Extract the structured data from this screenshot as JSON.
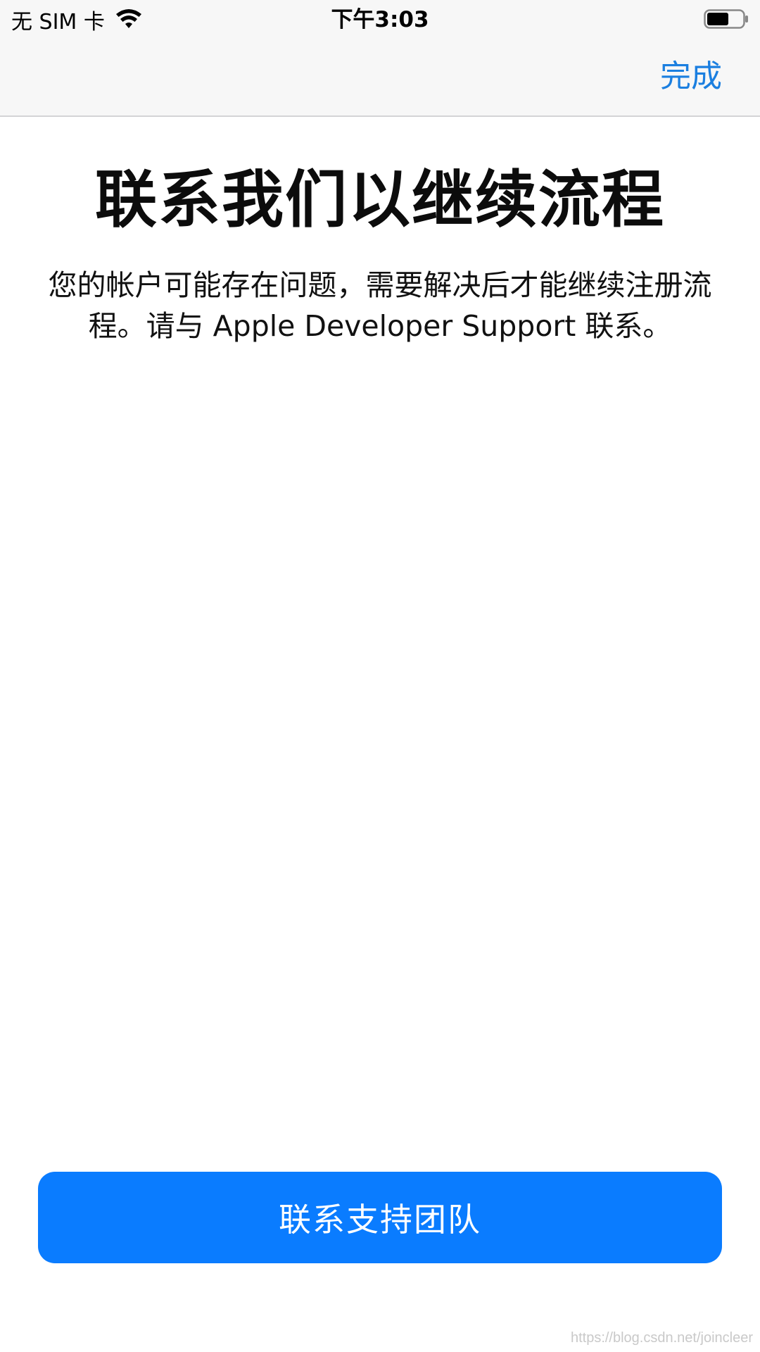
{
  "status_bar": {
    "carrier": "无 SIM 卡",
    "time": "下午3:03",
    "icons": [
      "wifi-icon",
      "battery-icon"
    ]
  },
  "nav": {
    "done_label": "完成"
  },
  "content": {
    "title": "联系我们以继续流程",
    "message": "您的帐户可能存在问题，需要解决后才能继续注册流程。请与 Apple Developer Support 联系。"
  },
  "actions": {
    "contact_support_label": "联系支持团队"
  },
  "watermark": "https://blog.csdn.net/joincleer",
  "colors": {
    "accent": "#0a7cff",
    "link": "#1b7fe0",
    "bar_background": "#f7f7f7"
  }
}
